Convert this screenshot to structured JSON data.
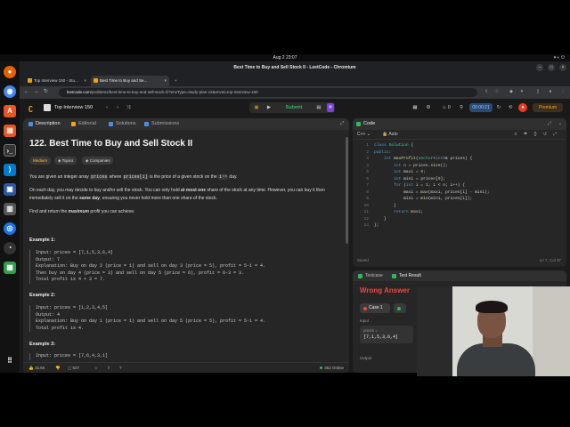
{
  "system": {
    "clock": "Aug 2  23:07"
  },
  "window": {
    "title": "Best Time to Buy and Sell Stock II - LeetCode - Chromium"
  },
  "tabs": [
    {
      "label": "Top Interview 150 - Stu..."
    },
    {
      "label": "Best Time to Buy and Se..."
    }
  ],
  "url": {
    "domain": "leetcode.com",
    "path": "/problems/best-time-to-buy-and-sell-stock-ii/?envType=study-plan-v2&envId=top-interview-150"
  },
  "lc_header": {
    "list_title": "Top Interview 150",
    "submit_label": "Submit",
    "timer": "00:00:21",
    "premium_label": "Premium"
  },
  "left_tabs": [
    "Description",
    "Editorial",
    "Solutions",
    "Submissions"
  ],
  "problem": {
    "title": "122. Best Time to Buy and Sell Stock II",
    "difficulty": "Medium",
    "topics": "Topics",
    "companies": "Companies",
    "p1_a": "You are given an integer array ",
    "p1_code1": "prices",
    "p1_b": " where ",
    "p1_code2": "prices[i]",
    "p1_c": " is the price of a given stock on the ",
    "p1_code3": "iᵗʰ",
    "p1_d": " day.",
    "p2_a": "On each day, you may decide to buy and/or sell the stock. You can only hold ",
    "p2_b": "at most one",
    "p2_c": " share of the stock at any time. However, you can buy it then immediately sell it on the ",
    "p2_d": "same day",
    "p2_e": ", ensuring you never hold more than one share of the stock.",
    "p3_a": "Find and return the ",
    "p3_b": "maximum",
    "p3_c": " profit you can achieve.",
    "ex1_title": "Example 1:",
    "ex1": "Input: prices = [7,1,5,3,6,4]\nOutput: 7\nExplanation: Buy on day 2 (price = 1) and sell on day 3 (price = 5), profit = 5-1 = 4.\nThen buy on day 4 (price = 3) and sell on day 5 (price = 6), profit = 6-3 = 3.\nTotal profit is 4 + 3 = 7.",
    "ex2_title": "Example 2:",
    "ex2": "Input: prices = [1,2,3,4,5]\nOutput: 4\nExplanation: Buy on day 1 (price = 1) and sell on day 5 (price = 5), profit = 5-1 = 4.\nTotal profit is 4.",
    "ex3_title": "Example 3:",
    "ex3": "Input: prices = [7,6,4,3,1]"
  },
  "footer": {
    "likes": "15.5K",
    "comments": "537",
    "online": "352 Online"
  },
  "code_panel": {
    "title": "Code",
    "language": "C++",
    "mode": "Auto",
    "status_left": "Saved",
    "status_right": "Ln 7, Col 37",
    "lines": [
      "class Solution {",
      "public:",
      "    int maxProfit(vector<int>& prices) {",
      "        int n = prices.size();",
      "        int maxi = 0;",
      "        int mini = prices[0];",
      "        for (int i = 1; i < n; i++) {",
      "            maxi = max(maxi, prices[i] - mini);",
      "            mini = min(mini, prices[i]);",
      "        }",
      "        return maxi;",
      "    }",
      "};"
    ]
  },
  "test_panel": {
    "tab1": "Testcase",
    "tab2": "Test Result",
    "verdict": "Wrong Answer",
    "case_label": "Case 1",
    "input_label": "Input",
    "var_name": "prices =",
    "var_value": "[7,1,5,3,6,4]",
    "output_label": "Output"
  },
  "colors": {
    "accent": "#ffa116",
    "success": "#2cbb5d",
    "error": "#ef4743"
  }
}
